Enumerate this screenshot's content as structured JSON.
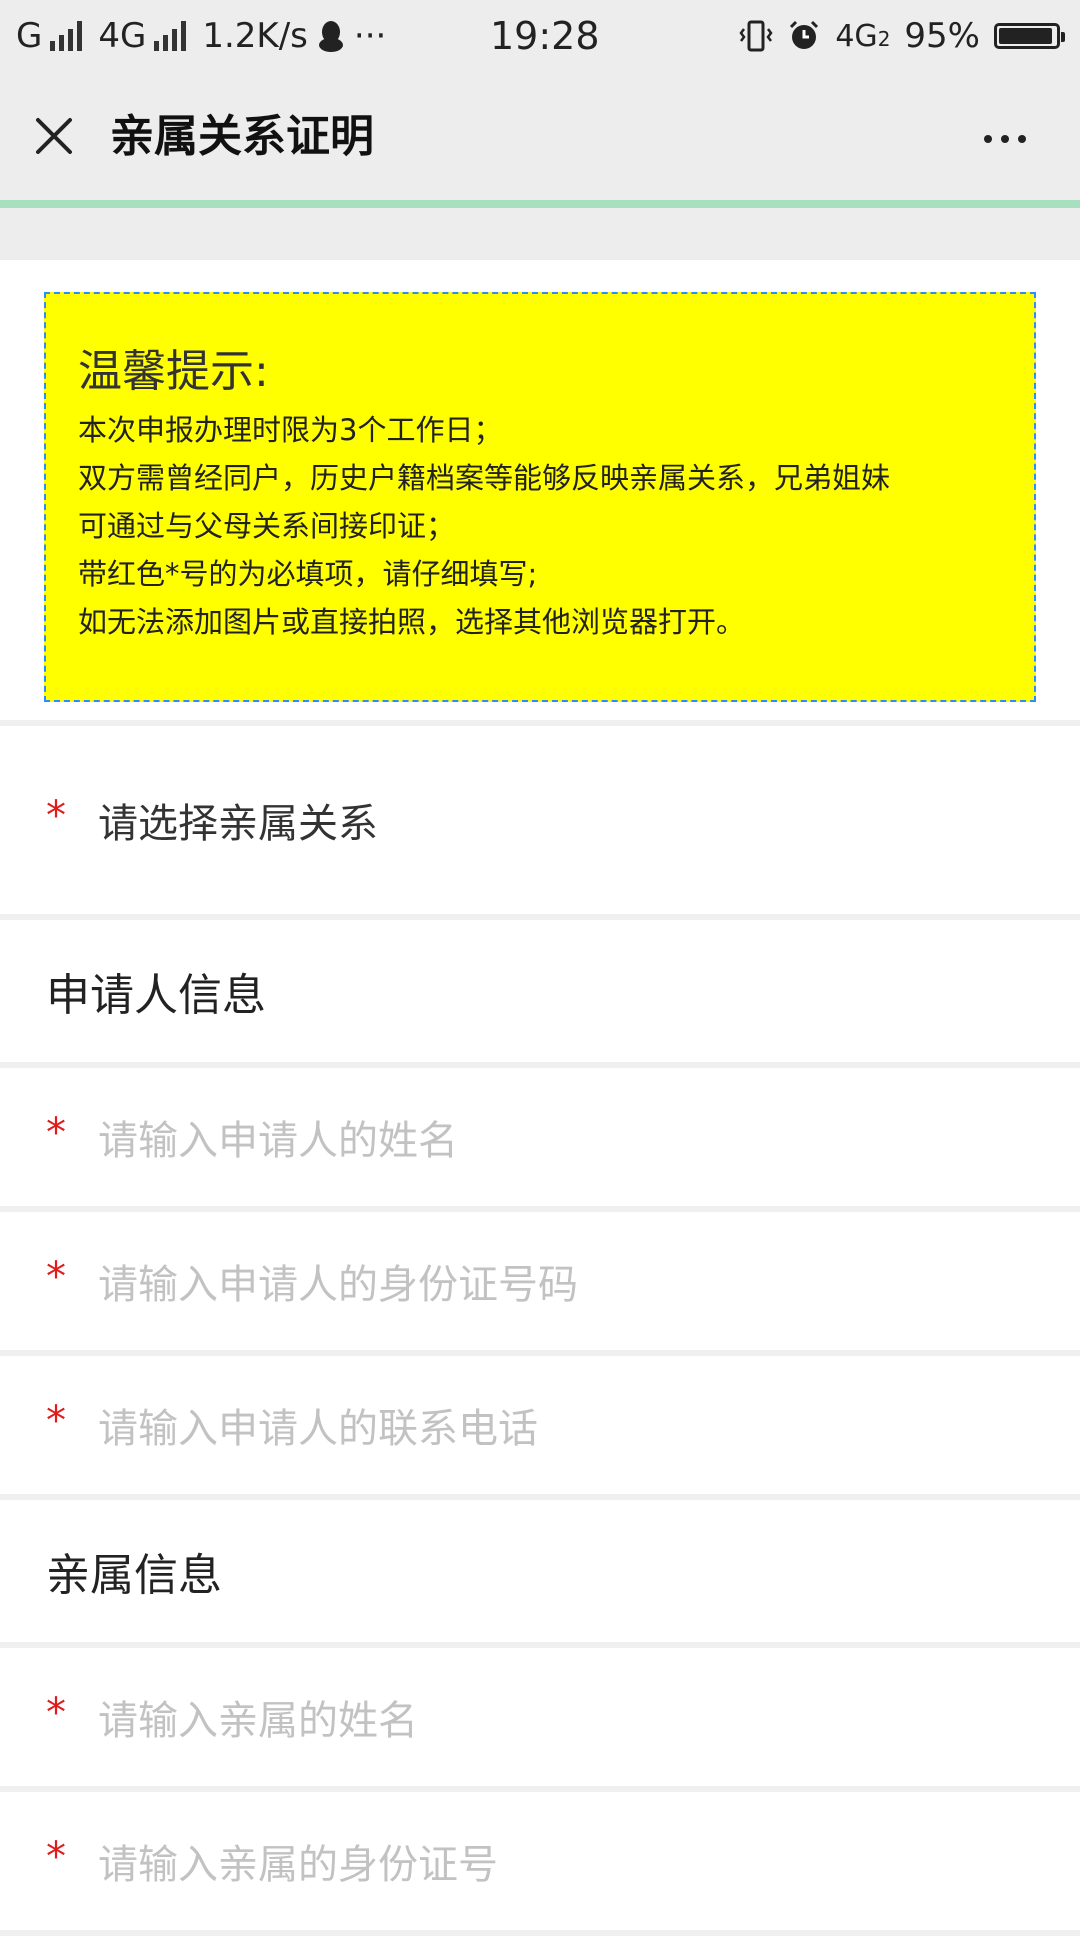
{
  "status_bar": {
    "carrier": "G",
    "network": "4G",
    "speed": "1.2K/s",
    "more": "···",
    "time": "19:28",
    "network_right": "4G",
    "network_right_sub": "2",
    "battery_percent": "95%",
    "battery_level": 0.95
  },
  "header": {
    "title": "亲属关系证明",
    "close_icon": "close-icon",
    "more_icon": "more-horizontal-icon"
  },
  "notice": {
    "title": "温馨提示:",
    "lines": [
      "本次申报办理时限为3个工作日；",
      "双方需曾经同户，历史户籍档案等能够反映亲属关系，兄弟姐妹",
      "可通过与父母关系间接印证；",
      "带红色*号的为必填项，请仔细填写;",
      "如无法添加图片或直接拍照，选择其他浏览器打开。"
    ],
    "background_color": "#ffff00",
    "border_color": "#2a8cff"
  },
  "form": {
    "required_mark": "*",
    "relation_select": "请选择亲属关系",
    "applicant_section": "申请人信息",
    "applicant_name_placeholder": "请输入申请人的姓名",
    "applicant_id_placeholder": "请输入申请人的身份证号码",
    "applicant_phone_placeholder": "请输入申请人的联系电话",
    "relative_section": "亲属信息",
    "relative_name_placeholder": "请输入亲属的姓名",
    "relative_id_placeholder": "请输入亲属的身份证号"
  }
}
